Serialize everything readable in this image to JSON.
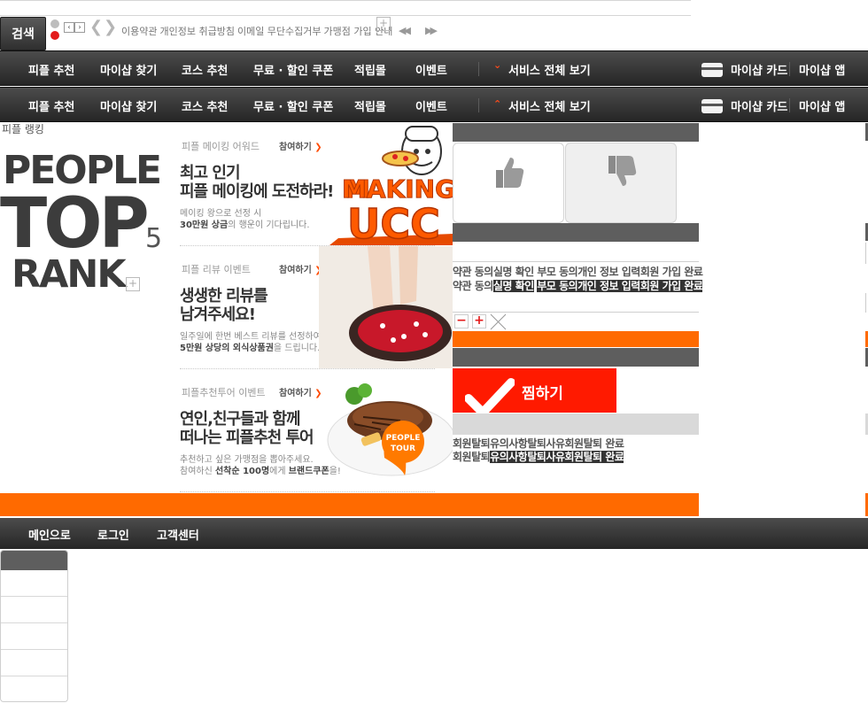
{
  "top": {
    "search_label": "검색",
    "mini_prev": "‹",
    "mini_next": "›",
    "links": [
      "이용약관",
      "개인정보 취급방침",
      "이메일 무단수집거부",
      "가맹점 가입 안내"
    ],
    "plus": "+"
  },
  "nav": {
    "items": [
      "피플 추천",
      "마이샵 찾기",
      "코스 추천",
      "무료 · 할인 쿠폰",
      "적립몰",
      "이벤트"
    ],
    "service_all": "서비스 전체 보기",
    "my_card": "마이샵 카드",
    "my_app": "마이샵 앱"
  },
  "ranking": {
    "heading": "피플 랭킹",
    "word1": "PEOPLE",
    "word2": "TOP",
    "number": "5",
    "word3": "RANK",
    "plus": "+"
  },
  "banners": [
    {
      "category": "피플 메이킹 어워드",
      "join": "참여하기",
      "headline_1": "최고 인기",
      "headline_2": "피플 메이킹에 도전하라!",
      "desc_1": "메이킹 왕으로 선정 시",
      "desc_2_strong": "30만원 상금",
      "desc_2_rest": "의 행운이 기다립니다.",
      "art_1": "MAKING",
      "art_2": "UCC"
    },
    {
      "category": "피플 리뷰 이벤트",
      "join": "참여하기",
      "headline_1": "생생한 리뷰를",
      "headline_2": "남겨주세요!",
      "desc_1": "일주일에 한번 베스트 리뷰를 선정하여",
      "desc_2_strong": "5만원 상당의 외식상품권",
      "desc_2_rest": "을 드립니다."
    },
    {
      "category": "피플추천투어 이벤트",
      "join": "참여하기",
      "headline_1": "연인,친구들과 함께",
      "headline_2": "떠나는 피플추천 투어",
      "desc_1": "추천하고 싶은 가맹점을 뽑아주세요.",
      "desc_2_pre": "참여하신 ",
      "desc_2_strong": "선착순 100명",
      "desc_2_mid": "에게 ",
      "desc_2_strong2": "브랜드쿠폰",
      "desc_2_rest": "을!",
      "badge_1": "PEOPLE",
      "badge_2": "TOUR"
    }
  ],
  "steps": [
    "약관 동의",
    "실명 확인",
    "부모 동의",
    "개인 정보 입력",
    "회원 가입 완료"
  ],
  "qty": {
    "minus": "−",
    "plus": "+"
  },
  "zzim_label": "찜하기",
  "withdraw_steps": [
    "회원탈퇴",
    "유의사항",
    "탈퇴사유",
    "회원탈퇴 완료"
  ],
  "footer_nav": [
    "메인으로",
    "로그인",
    "고객센터"
  ],
  "colors": {
    "accent_orange": "#ff6a00",
    "zzim_red": "#ff1a00",
    "nav_dark": "#2f2f2f"
  }
}
